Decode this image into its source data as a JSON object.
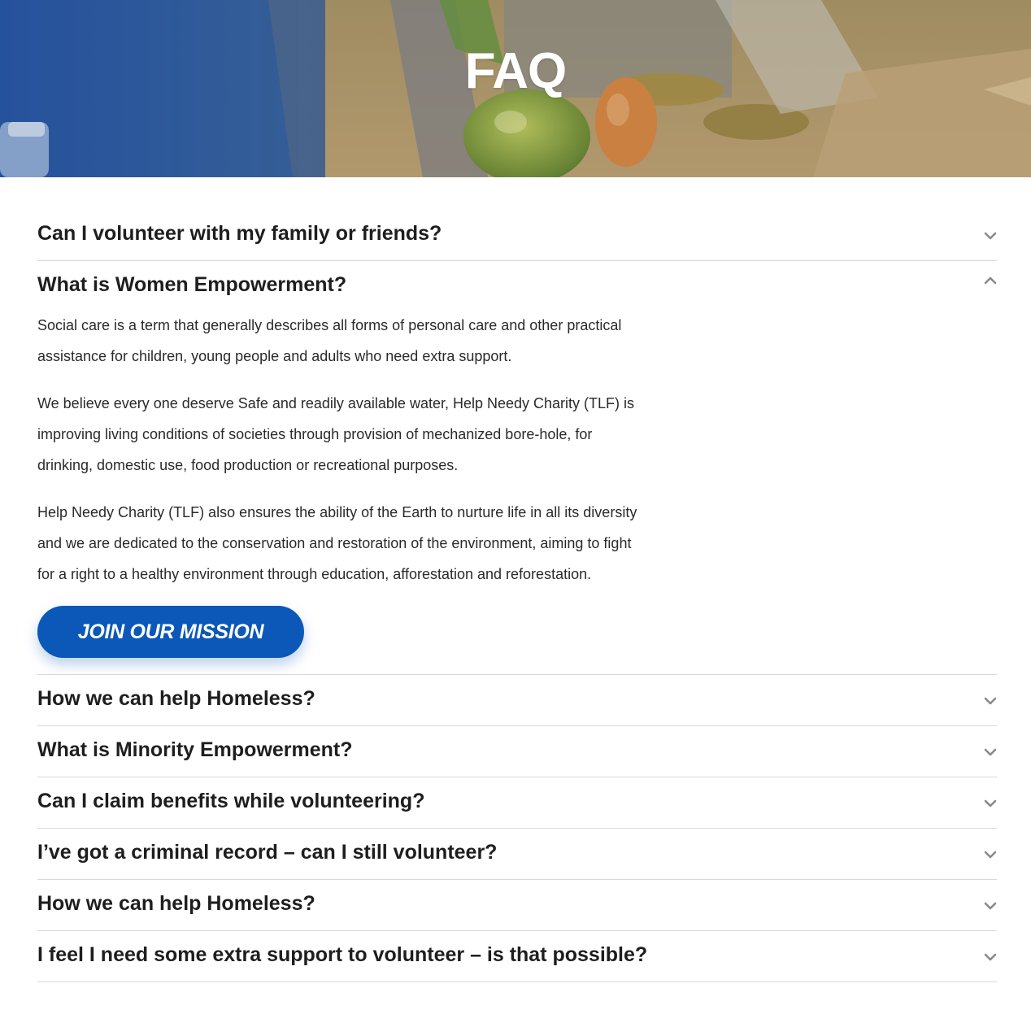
{
  "hero": {
    "title": "FAQ"
  },
  "faq": {
    "items": [
      {
        "question": "Can I volunteer with my family or friends?"
      },
      {
        "question": "What is Women Empowerment?",
        "answer": [
          "Social care is a term that generally describes all forms of personal care and other practical assistance for children, young people and adults who need extra support.",
          "We believe every one deserve Safe and readily available water, Help Needy Charity (TLF) is improving living conditions of societies through provision of mechanized bore-hole, for drinking, domestic use, food production or recreational purposes.",
          "Help Needy Charity (TLF) also ensures the ability of the Earth to nurture life in all its diversity and we are dedicated to the conservation and restoration of the environment, aiming to fight for a right to a healthy environment through education, afforestation and reforestation."
        ],
        "cta_label": "JOIN OUR MISSION"
      },
      {
        "question": "How we can help Homeless?"
      },
      {
        "question": "What is Minority Empowerment?"
      },
      {
        "question": "Can I claim benefits while volunteering?"
      },
      {
        "question": "I’ve got a criminal record – can I still volunteer?"
      },
      {
        "question": "How we can help Homeless?"
      },
      {
        "question": "I feel I need some extra support to volunteer – is that possible?"
      }
    ]
  },
  "icons": {
    "collapsed": "chevron-down-icon",
    "expanded": "chevron-up-icon"
  },
  "colors": {
    "accent": "#0b58b8",
    "text": "#1e1e1e",
    "divider": "#d8d8d8",
    "chevron": "#8a8a8a"
  }
}
